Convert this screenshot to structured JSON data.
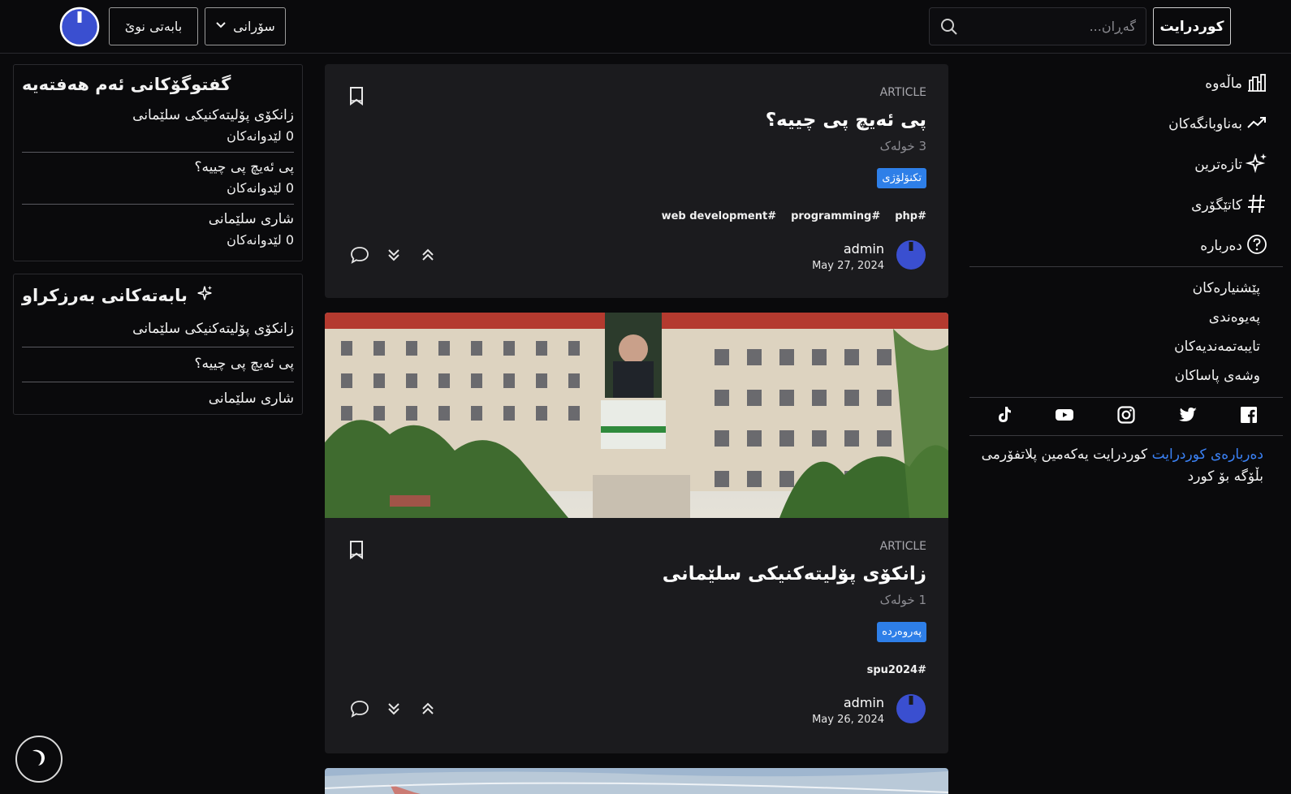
{
  "header": {
    "brand_label": "کوردرایت",
    "search_placeholder": "گەڕان...",
    "sort_label": "سۆرانی",
    "new_post_label": "بابەتی نوێ"
  },
  "sidebar": {
    "nav": [
      {
        "label": "ماڵەوە",
        "icon": "home-icon"
      },
      {
        "label": "بەناوبانگەکان",
        "icon": "trending-icon"
      },
      {
        "label": "تازەترین",
        "icon": "sparkles-icon"
      },
      {
        "label": "کاتێگۆری",
        "icon": "hash-icon"
      },
      {
        "label": "دەربارە",
        "icon": "question-circle-icon"
      }
    ],
    "links": [
      "پێشنیارەکان",
      "پەیوەندی",
      "تایبەتمەندیەکان",
      "وشەی پاساکان"
    ],
    "socials": [
      "tiktok-icon",
      "youtube-icon",
      "instagram-icon",
      "twitter-icon",
      "facebook-icon"
    ],
    "about_highlight": "دەربارەی کوردرایت",
    "about_text": " کوردرایت یەکەمین پلاتفۆرمی بڵۆگە بۆ کورد"
  },
  "posts": [
    {
      "type": "ARTICLE",
      "title": "پی ئەیچ پی چییە؟",
      "read_time": "3 خولەک",
      "category": "تکنۆلۆژی",
      "tags": [
        "web development#",
        "programming#",
        "php#"
      ],
      "author": "admin",
      "date": "May 27, 2024"
    },
    {
      "type": "ARTICLE",
      "title": "زانکۆی پۆلیتەکنیکی سلێمانی",
      "read_time": "1 خولەک",
      "category": "پەروەردە",
      "tags": [
        "spu2024#"
      ],
      "author": "admin",
      "date": "May 26, 2024"
    }
  ],
  "discussions": {
    "title": "گفتوگۆکانی ئەم هەفتەیە",
    "items": [
      {
        "title": "زانکۆی پۆلیتەکنیکی سلێمانی",
        "sub": "0 لێدوانەکان"
      },
      {
        "title": "پی ئەیچ پی چییە؟",
        "sub": "0 لێدوانەکان"
      },
      {
        "title": "شاری سلێمانی",
        "sub": "0 لێدوانەکان"
      }
    ]
  },
  "featured": {
    "title": "بابەتەکانی بەرزکراو",
    "items": [
      "زانکۆی پۆلیتەکنیکی سلێمانی",
      "پی ئەیچ پی چییە؟",
      "شاری سلێمانی"
    ]
  },
  "colors": {
    "background": "#0a0a0c",
    "card": "#1b1b1e",
    "accent": "#2e7fe8",
    "link": "#3b82f6"
  }
}
